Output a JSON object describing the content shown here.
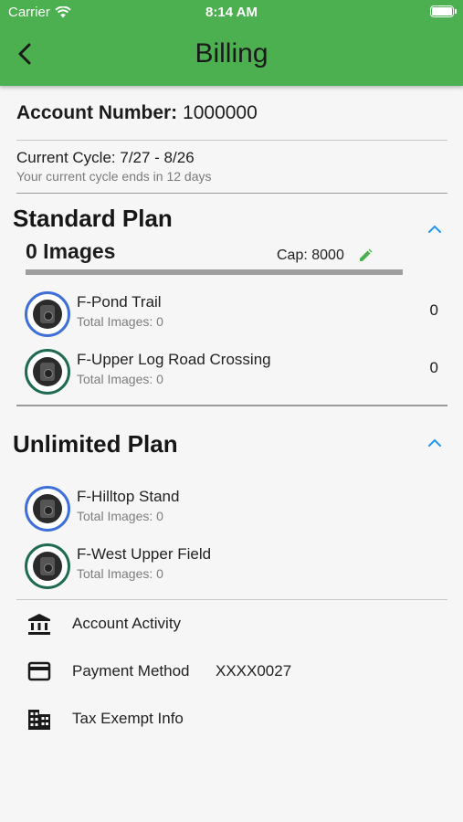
{
  "status_bar": {
    "carrier": "Carrier",
    "time": "8:14 AM"
  },
  "header": {
    "title": "Billing"
  },
  "account": {
    "label": "Account Number:",
    "number": "1000000"
  },
  "cycle": {
    "current": "Current Cycle: 7/27 - 8/26",
    "note": "Your current cycle ends in 12 days"
  },
  "standard_plan": {
    "title": "Standard Plan",
    "images": "0 Images",
    "cap": "Cap: 8000",
    "usage_fraction": 0,
    "cameras": [
      {
        "name": "F-Pond Trail",
        "sub": "Total Images: 0",
        "count": "0",
        "ring": "blue"
      },
      {
        "name": "F-Upper Log Road Crossing",
        "sub": "Total Images: 0",
        "count": "0",
        "ring": "green"
      }
    ]
  },
  "unlimited_plan": {
    "title": "Unlimited Plan",
    "cameras": [
      {
        "name": "F-Hilltop Stand",
        "sub": "Total Images: 0",
        "ring": "blue"
      },
      {
        "name": "F-West Upper Field",
        "sub": "Total Images: 0",
        "ring": "green"
      }
    ]
  },
  "menu": {
    "account_activity": "Account Activity",
    "payment_method": "Payment Method",
    "payment_value": "XXXX0027",
    "tax_exempt": "Tax Exempt Info"
  },
  "colors": {
    "header": "#4caf50",
    "accent": "#2196f3",
    "ring_blue": "#3f6fd8",
    "ring_green": "#1e6a52"
  }
}
